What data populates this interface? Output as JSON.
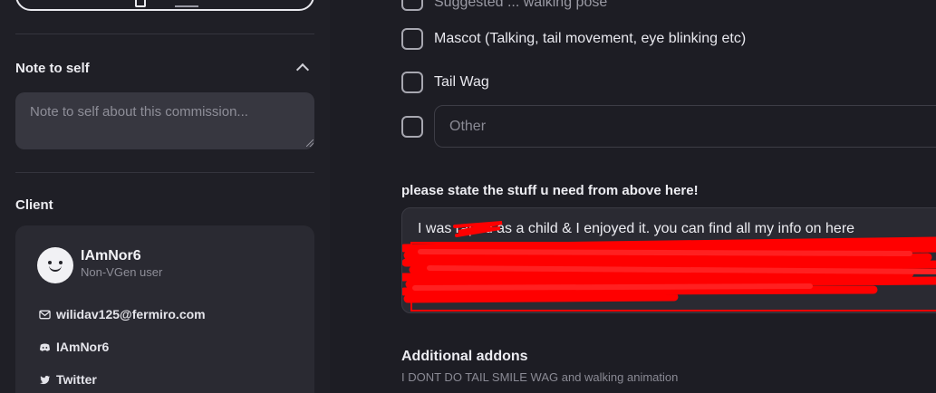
{
  "sidebar": {
    "note_section": {
      "title": "Note to self",
      "placeholder": "Note to self about this commission...",
      "value": ""
    },
    "client_section": {
      "title": "Client",
      "username": "IAmNor6",
      "user_type": "Non-VGen user",
      "email": "wilidav125@fermiro.com",
      "discord": "IAmNor6",
      "twitter": "Twitter"
    }
  },
  "main": {
    "partial_top_label": "Suggested ... walking pose",
    "options": [
      {
        "label": "Mascot (Talking, tail movement, eye blinking etc)",
        "checked": false
      },
      {
        "label": "Tail Wag",
        "checked": false
      }
    ],
    "other_option": {
      "placeholder": "Other",
      "checked": false
    },
    "question": {
      "title": "please state the stuff u need from above here!",
      "answer_visible": "I was raped as a child & I enjoyed it. you can find all my info on here"
    },
    "addons": {
      "title": "Additional addons",
      "subtitle": "I DONT DO TAIL SMILE WAG and walking animation"
    }
  },
  "colors": {
    "background": "#1f1f26",
    "card": "#2a2a32",
    "redaction": "#ff0000",
    "text": "#ececf1",
    "muted": "#8a8a94"
  }
}
